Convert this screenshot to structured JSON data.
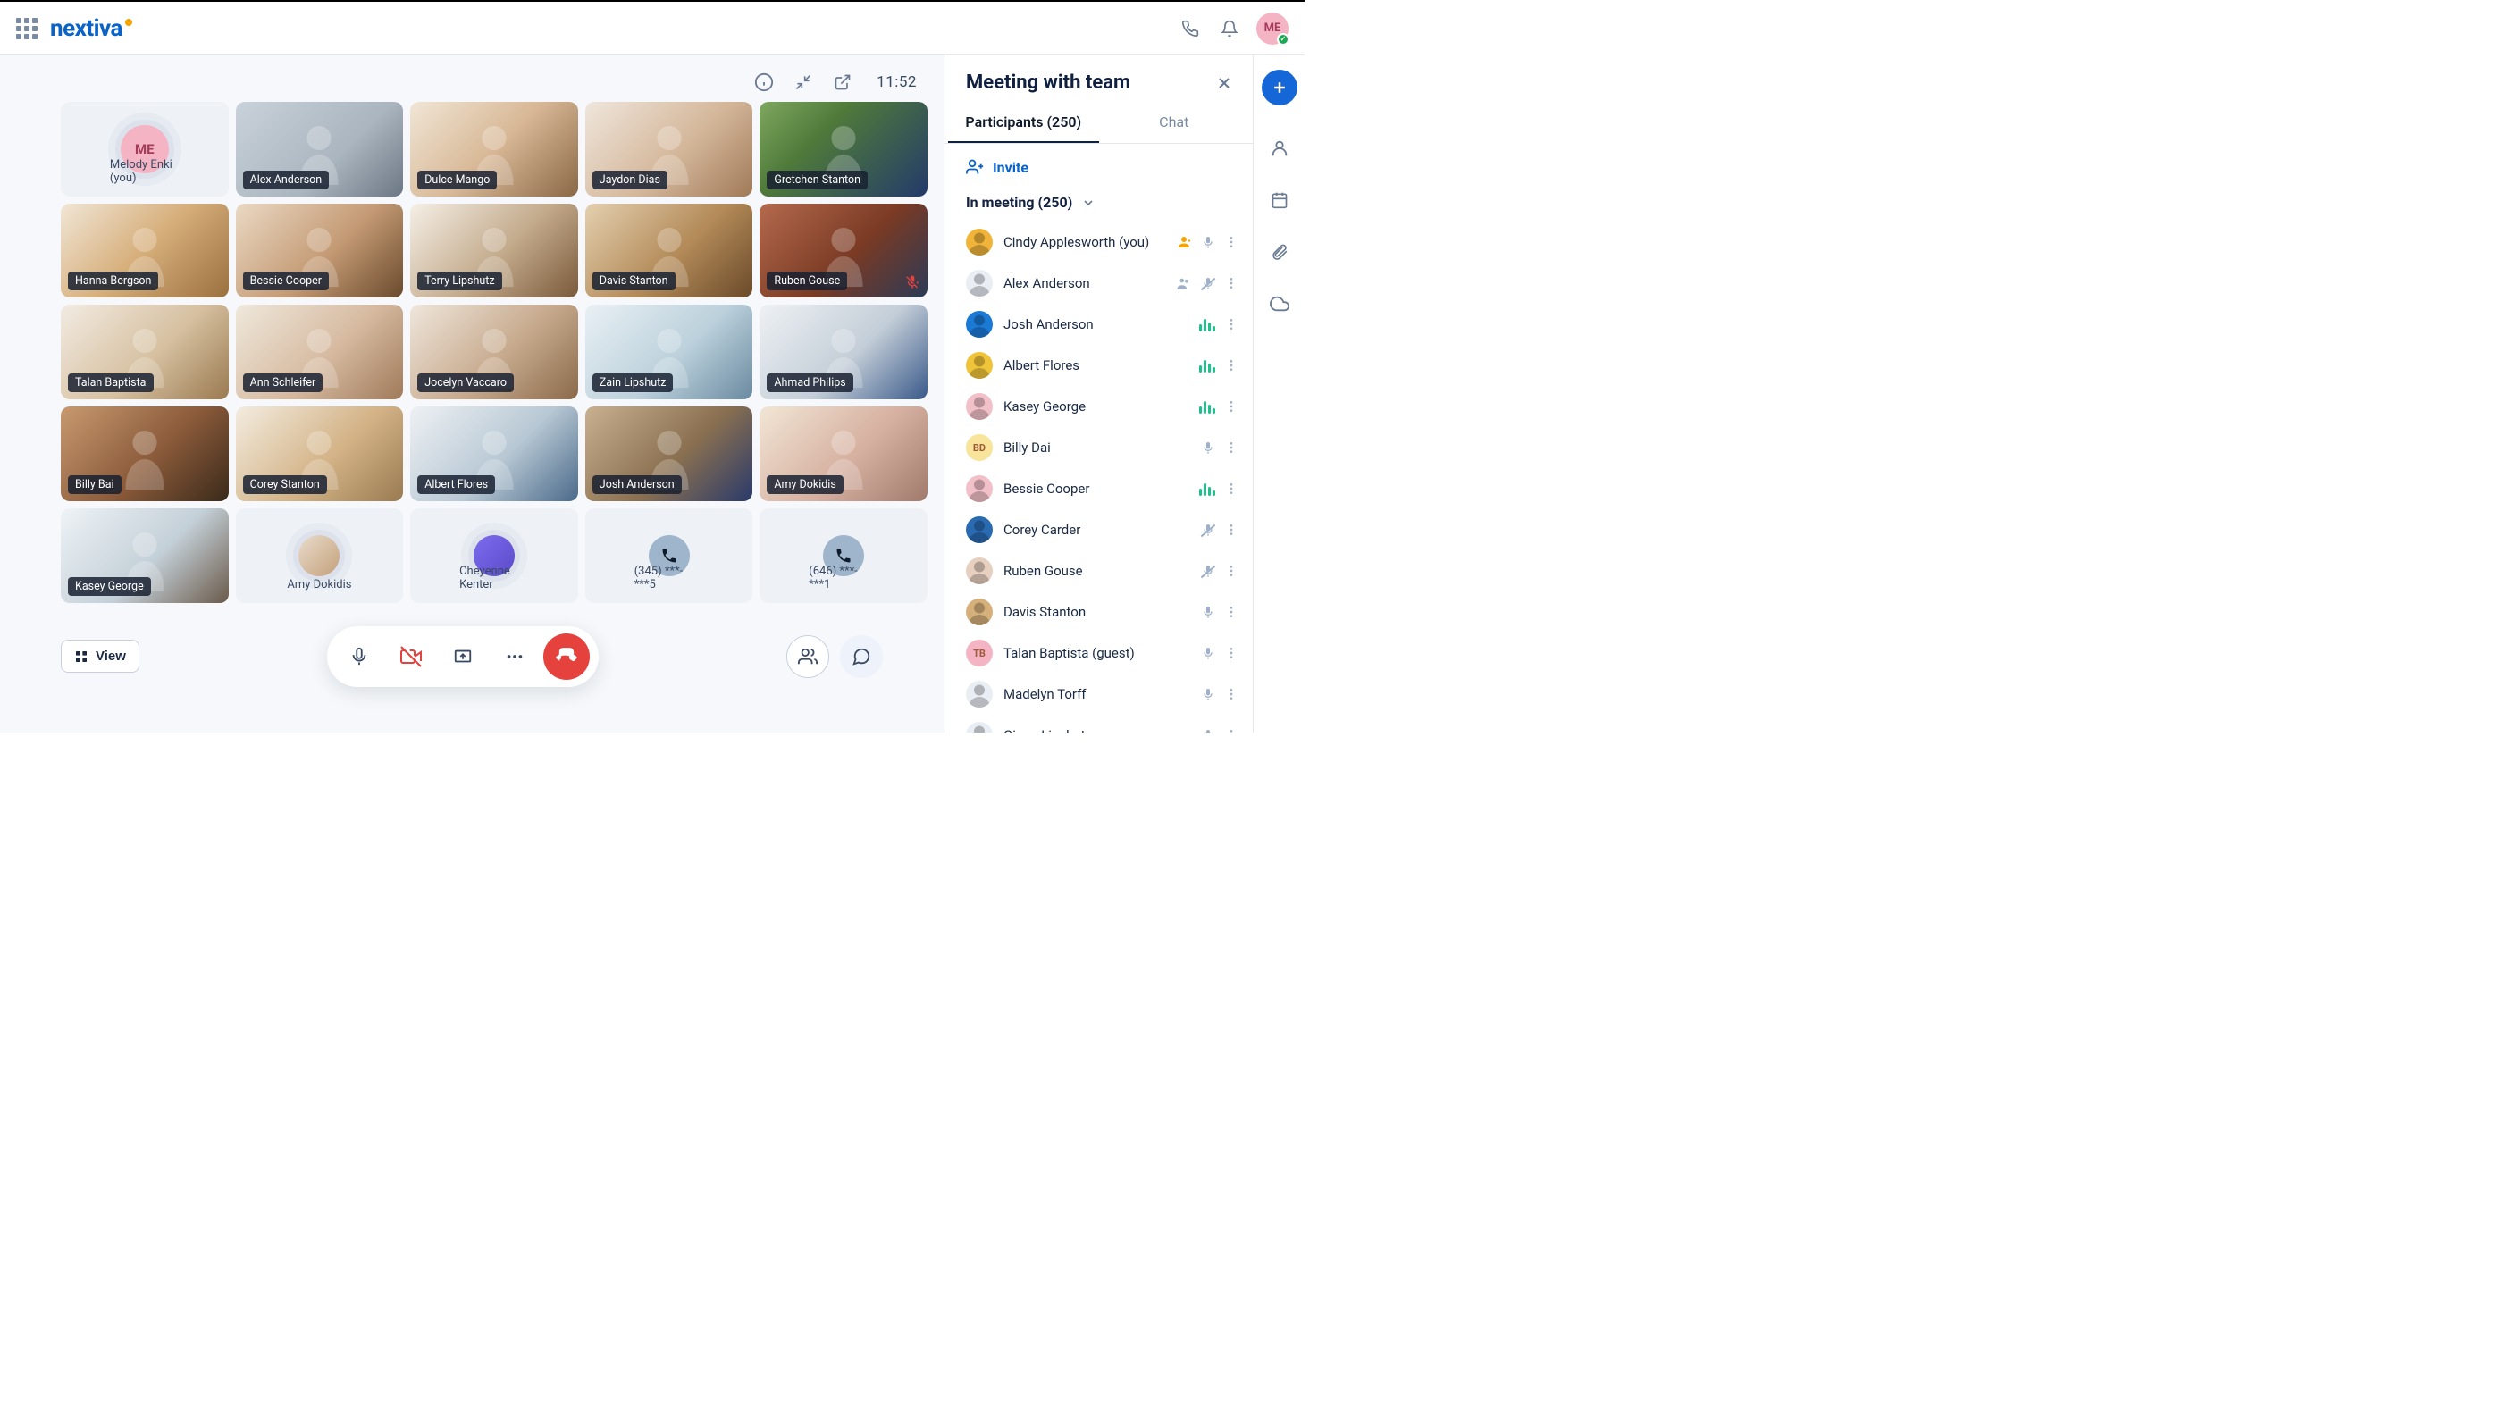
{
  "header": {
    "brand": "nextiva",
    "avatar_initials": "ME"
  },
  "meeting": {
    "time": "11:52",
    "view_button": "View",
    "tiles": [
      {
        "name": "Melody Enki (you)",
        "type": "avatar_initials",
        "initials": "ME",
        "colors": [
          "#f5b4c4",
          "#a63a5a"
        ]
      },
      {
        "name": "Alex Anderson",
        "type": "video",
        "bg": "linear-gradient(135deg,#c9d2da 0%,#aab5bf 60%,#6c7784 100%)"
      },
      {
        "name": "Dulce Mango",
        "type": "video",
        "bg": "linear-gradient(135deg,#f0e6d6 0%,#d8b896 50%,#8a6846 100%)"
      },
      {
        "name": "Jaydon Dias",
        "type": "video",
        "bg": "linear-gradient(135deg,#efe6dc 0%,#d4b79a 55%,#a07a58 100%)"
      },
      {
        "name": "Gretchen Stanton",
        "type": "video",
        "bg": "linear-gradient(135deg,#7ea85f 0%,#4f7a3a 35%,#233a6a 100%)"
      },
      {
        "name": "Hanna Bergson",
        "type": "video",
        "bg": "linear-gradient(135deg,#f1e6d6 0%,#d6ae7a 50%,#9a703f 100%)"
      },
      {
        "name": "Bessie Cooper",
        "type": "video",
        "bg": "linear-gradient(135deg,#ead9c4 0%,#c49a74 55%,#6a4a2d 100%)"
      },
      {
        "name": "Terry Lipshutz",
        "type": "video",
        "bg": "linear-gradient(135deg,#f5efe6 0%,#c2a98a 55%,#7a5a3a 100%)"
      },
      {
        "name": "Davis Stanton",
        "type": "video",
        "bg": "linear-gradient(135deg,#e4d0b0 0%,#b38a58 55%,#6a4a2a 100%)"
      },
      {
        "name": "Ruben Gouse",
        "type": "video",
        "bg": "linear-gradient(135deg,#b46a4d 0%,#7a3a24 55%,#2c3a56 100%)",
        "muted": true
      },
      {
        "name": "Talan Baptista",
        "type": "video",
        "bg": "linear-gradient(135deg,#f2ebe2 0%,#d6c0a0 55%,#9a7a50 100%)"
      },
      {
        "name": "Ann Schleifer",
        "type": "video",
        "bg": "linear-gradient(135deg,#efe8dc 0%,#d6baa0 55%,#a07a5a 100%)"
      },
      {
        "name": "Jocelyn Vaccaro",
        "type": "video",
        "bg": "linear-gradient(135deg,#efe6dc 0%,#c7aa8d 55%,#8a6a4a 100%)"
      },
      {
        "name": "Zain Lipshutz",
        "type": "video",
        "bg": "linear-gradient(135deg,#e9f0f4 0%,#bcd1dc 55%,#6a8aa0 100%)"
      },
      {
        "name": "Ahmad Philips",
        "type": "video",
        "bg": "linear-gradient(135deg,#eef1f4 0%,#c4ced8 55%,#3a5a8a 100%)"
      },
      {
        "name": "Billy Bai",
        "type": "video",
        "bg": "linear-gradient(135deg,#c89a70 0%,#8a5a3a 55%,#3a2a1a 100%)"
      },
      {
        "name": "Corey Stanton",
        "type": "video",
        "bg": "linear-gradient(135deg,#f3ece0 0%,#d4b488 55%,#9a7a50 100%)"
      },
      {
        "name": "Albert Flores",
        "type": "video",
        "bg": "linear-gradient(135deg,#eef1f4 0%,#b8c8d4 55%,#4a6a8a 100%)"
      },
      {
        "name": "Josh Anderson",
        "type": "video",
        "bg": "linear-gradient(135deg,#c8b090 0%,#8a7050 55%,#2a3a6a 100%)"
      },
      {
        "name": "Amy Dokidis",
        "type": "video",
        "bg": "linear-gradient(135deg,#f2e6d6 0%,#d6b0a0 55%,#a07a6a 100%)"
      },
      {
        "name": "Kasey George",
        "type": "video",
        "bg": "linear-gradient(135deg,#eef3f6 0%,#c4d0d8 55%,#6a5a4a 100%)"
      },
      {
        "name": "Amy Dokidis",
        "type": "avatar_photo",
        "bg": "linear-gradient(135deg,#e9dccc,#c4a07a)"
      },
      {
        "name": "Cheyenne Kenter",
        "type": "avatar_photo",
        "bg": "linear-gradient(135deg,#7e6cf0,#5a4ac8)"
      },
      {
        "name": "(345) ***-***5",
        "type": "phone"
      },
      {
        "name": "(646) ***-***1",
        "type": "phone"
      }
    ]
  },
  "panel": {
    "title": "Meeting with team",
    "tabs": {
      "participants": "Participants (250)",
      "chat": "Chat"
    },
    "invite": "Invite",
    "section": "In meeting (250)",
    "participants": [
      {
        "name": "Cindy Applesworth (you)",
        "avatar_bg": "#f0b43a",
        "host": true,
        "mic": "on"
      },
      {
        "name": "Alex Anderson",
        "avatar_bg": "#e8eef4",
        "mic": "muted",
        "cohost": true
      },
      {
        "name": "Josh Anderson",
        "avatar_bg": "#1a7ad6",
        "mic": "speaking"
      },
      {
        "name": "Albert Flores",
        "avatar_bg": "#f0c43a",
        "mic": "speaking"
      },
      {
        "name": "Kasey George",
        "avatar_bg": "#f2c0c8",
        "mic": "speaking"
      },
      {
        "name": "Billy Dai",
        "avatar_bg": "#f8e49a",
        "initials": "BD",
        "mic": "idle"
      },
      {
        "name": "Bessie Cooper",
        "avatar_bg": "#f2c0c8",
        "mic": "speaking"
      },
      {
        "name": "Corey Carder",
        "avatar_bg": "#2a6ab0",
        "mic": "muted"
      },
      {
        "name": "Ruben Gouse",
        "avatar_bg": "#e8d0c0",
        "mic": "muted"
      },
      {
        "name": "Davis Stanton",
        "avatar_bg": "#d6b07a",
        "mic": "idle"
      },
      {
        "name": "Talan Baptista (guest)",
        "avatar_bg": "#f5b4c4",
        "initials": "TB",
        "mic": "idle"
      },
      {
        "name": "Madelyn Torff",
        "avatar_bg": "#e8eef4",
        "mic": "idle"
      },
      {
        "name": "Giana Lipshutz",
        "avatar_bg": "#e8eef4",
        "mic": "idle"
      }
    ]
  }
}
